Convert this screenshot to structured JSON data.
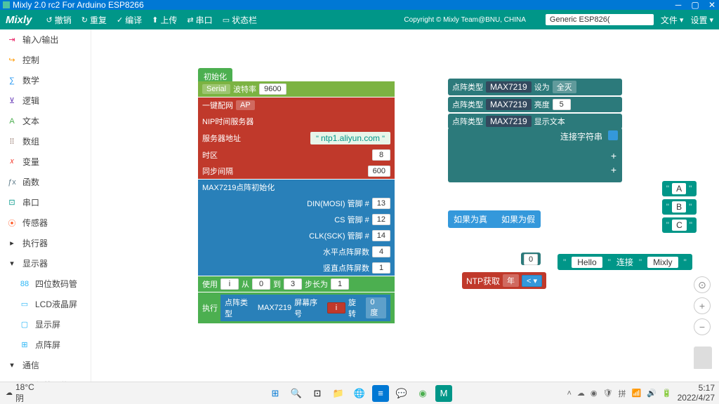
{
  "titlebar": {
    "text": "Mixly 2.0 rc2 For Arduino ESP8266"
  },
  "toolbar": {
    "logo": "Mixly",
    "undo": "撤销",
    "redo": "重复",
    "compile": "编译",
    "upload": "上传",
    "serial": "串口",
    "statusbar": "状态栏",
    "copyright": "Copyright © Mixly Team@BNU, CHINA",
    "board": "Generic ESP826(",
    "file": "文件",
    "settings": "设置"
  },
  "sidebar": {
    "items": [
      "输入/输出",
      "控制",
      "数学",
      "逻辑",
      "文本",
      "数组",
      "变量",
      "函数",
      "串口",
      "传感器",
      "执行器",
      "显示器"
    ],
    "display_sub": [
      "四位数码管",
      "LCD液晶屏",
      "显示屏",
      "点阵屏"
    ],
    "comm": "通信",
    "ir": "红外通信"
  },
  "blocks": {
    "init": "初始化",
    "serial": {
      "label": "Serial",
      "baud": "波特率",
      "value": "9600"
    },
    "nip": {
      "onekey": "一键配网",
      "ap": "AP",
      "server": "NIP时间服务器",
      "addr_label": "服务器地址",
      "addr": "ntp1.aliyun.com",
      "tz": "时区",
      "tz_val": "8",
      "sync": "同步间隔",
      "sync_val": "600"
    },
    "max_init": {
      "title": "MAX7219点阵初始化",
      "din": "DIN(MOSI)  管脚 #",
      "din_v": "13",
      "cs": "CS  管脚 #",
      "cs_v": "12",
      "clk": "CLK(SCK)  管脚 #",
      "clk_v": "14",
      "hcount": "水平点阵屏数",
      "hcount_v": "4",
      "vcount": "竖直点阵屏数",
      "vcount_v": "1"
    },
    "loop": {
      "use": "使用",
      "from": "从",
      "from_v": "0",
      "to": "到",
      "to_v": "3",
      "step": "步长为",
      "step_v": "1",
      "exec": "执行",
      "matrix_type": "点阵类型",
      "max": "MAX7219",
      "screen": "屏幕序号",
      "rotate": "旋转",
      "deg": "0度"
    },
    "matrix2": {
      "type": "点阵类型",
      "max": "MAX7219",
      "set": "设为",
      "alloff": "全灭",
      "bright": "亮度",
      "bright_v": "5",
      "showtext": "显示文本",
      "join": "连接字符串"
    },
    "if": {
      "true": "如果为真",
      "false": "如果为假"
    },
    "zero": "0",
    "hello": {
      "h": "Hello",
      "join": "连接",
      "m": "Mixly"
    },
    "ntp": {
      "get": "NTP获取",
      "year": "年"
    },
    "vars": [
      "A",
      "B",
      "C"
    ]
  },
  "taskbar": {
    "temp": "18°C",
    "weather": "阴",
    "time": "5:17",
    "date": "2022/4/27"
  }
}
